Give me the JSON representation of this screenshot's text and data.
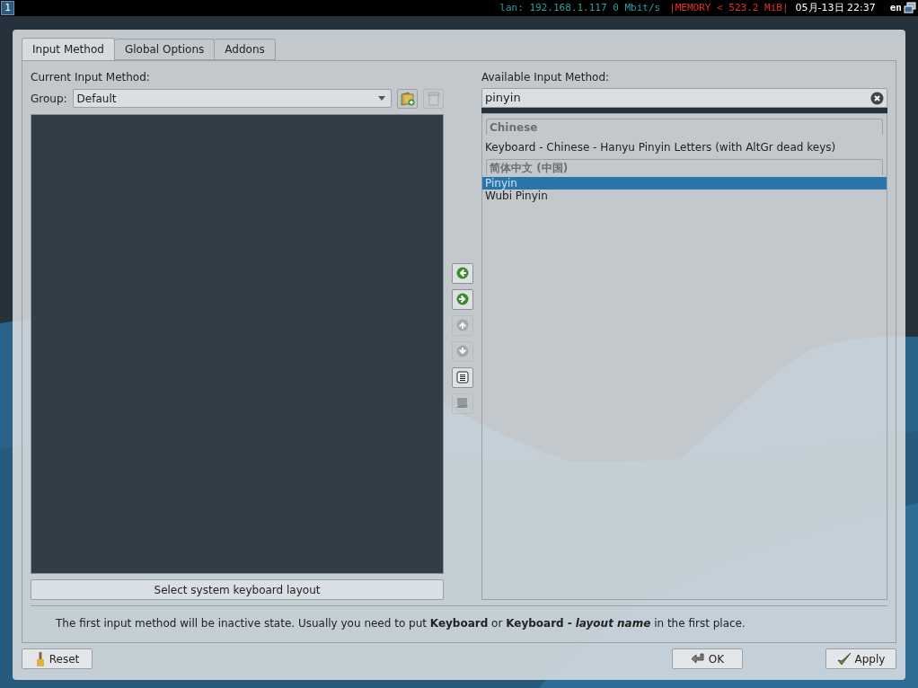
{
  "taskbar": {
    "workspace": "1",
    "network": "lan: 192.168.1.117 0 Mbit/s",
    "memory": "|MEMORY < 523.2 MiB|",
    "datetime": "05月-13日 22:37",
    "layout": "en"
  },
  "tabs": [
    {
      "label": "Input Method",
      "selected": true
    },
    {
      "label": "Global Options",
      "selected": false
    },
    {
      "label": "Addons",
      "selected": false
    }
  ],
  "current": {
    "label": "Current Input Method:",
    "group_label": "Group:",
    "group_value": "Default",
    "keyboard_button": "Select system keyboard layout"
  },
  "available": {
    "label": "Available Input Method:",
    "search_value": "pinyin",
    "items": [
      {
        "kind": "header",
        "text": "Chinese",
        "selected": false
      },
      {
        "kind": "item",
        "text": "Keyboard - Chinese - Hanyu Pinyin Letters (with AltGr dead keys)",
        "selected": false
      },
      {
        "kind": "header",
        "text": "简体中文 (中国)",
        "selected": false
      },
      {
        "kind": "item",
        "text": "Pinyin",
        "selected": true
      },
      {
        "kind": "item",
        "text": "Wubi Pinyin",
        "selected": false
      }
    ]
  },
  "side_buttons": [
    {
      "kind": "left",
      "disabled": false
    },
    {
      "kind": "right",
      "disabled": false
    },
    {
      "kind": "up",
      "disabled": true
    },
    {
      "kind": "down",
      "disabled": true
    },
    {
      "kind": "configure",
      "disabled": false
    },
    {
      "kind": "keyboard",
      "disabled": true
    }
  ],
  "hint": "The first input method will be inactive state. Usually you need to put **Keyboard** or **Keyboard -** *layout name* in the first place.",
  "buttons": [
    {
      "kind": "reset",
      "label": "Reset"
    },
    {
      "kind": "ok",
      "label": "OK"
    },
    {
      "kind": "apply",
      "label": "Apply"
    }
  ]
}
